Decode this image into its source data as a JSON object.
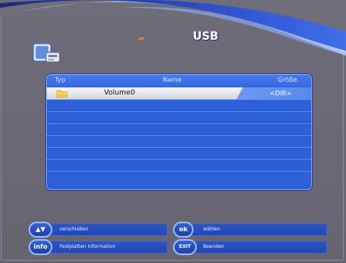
{
  "header": {
    "arrows": "›››",
    "title": "USB"
  },
  "app_icon": "usb-storage-icon",
  "file_list": {
    "columns": {
      "type": "Typ",
      "name": "Name",
      "size": "Größe"
    },
    "rows": [
      {
        "type_icon": "folder-icon",
        "name": "Volume0",
        "size": "<DIR>",
        "selected": true
      }
    ],
    "empty_rows": 7
  },
  "hints": [
    {
      "key": "▲▼",
      "label": "verschieben"
    },
    {
      "key": "ok",
      "label": "wählen"
    },
    {
      "key": "info",
      "label": "Festplatten Information"
    },
    {
      "key": "EXIT",
      "label": "Beenden"
    }
  ],
  "colors": {
    "background": "#6c6a76",
    "panel": "#2c5fd8",
    "panel_header": "#4a7cf0",
    "selection": "#f0f0f5",
    "accent_orange": "#f0a030",
    "hint_bar": "#2a4fc0"
  }
}
